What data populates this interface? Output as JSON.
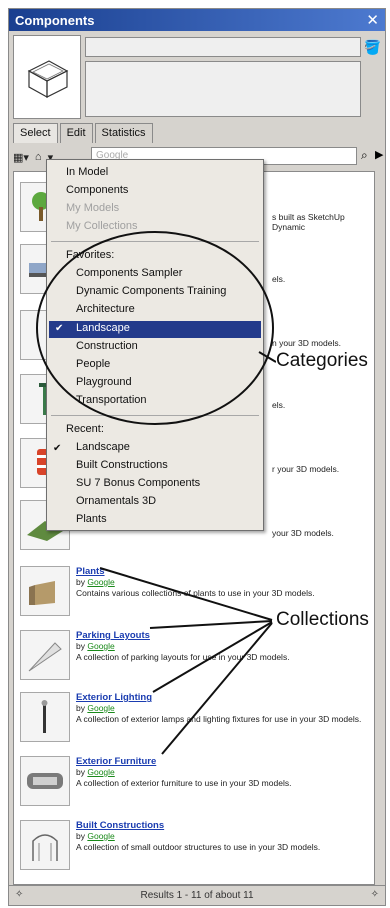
{
  "window": {
    "title": "Components"
  },
  "tabs": [
    {
      "label": "Select"
    },
    {
      "label": "Edit"
    },
    {
      "label": "Statistics"
    }
  ],
  "search": {
    "placeholder": "Google"
  },
  "menu": {
    "top": [
      "In Model",
      "Components"
    ],
    "top_disabled": [
      "My Models",
      "My Collections"
    ],
    "favorites_label": "Favorites:",
    "favorites": [
      "Components Sampler",
      "Dynamic Components Training",
      "Architecture",
      "Landscape",
      "Construction",
      "People",
      "Playground",
      "Transportation"
    ],
    "selected": "Landscape",
    "recent_label": "Recent:",
    "recent": [
      "Landscape",
      "Built Constructions",
      "SU 7 Bonus Components",
      "Ornamentals 3D",
      "Plants"
    ]
  },
  "partial_descriptions": [
    "s built as SketchUp Dynamic",
    "els.",
    "n your 3D models.",
    "els.",
    "r your 3D models.",
    "your 3D models."
  ],
  "results": [
    {
      "title": "Plants",
      "by": "by",
      "author": "Google",
      "desc": "Contains various collections of plants to use in your 3D models."
    },
    {
      "title": "Parking Layouts",
      "by": "by",
      "author": "Google",
      "desc": "A collection of parking layouts for use in your 3D models."
    },
    {
      "title": "Exterior Lighting",
      "by": "by",
      "author": "Google",
      "desc": "A collection of exterior lamps and lighting fixtures for use in your 3D models."
    },
    {
      "title": "Exterior Furniture",
      "by": "by",
      "author": "Google",
      "desc": "A collection of exterior furniture to use in your 3D models."
    },
    {
      "title": "Built Constructions",
      "by": "by",
      "author": "Google",
      "desc": "A collection of small outdoor structures to use in your 3D models."
    }
  ],
  "status": {
    "text": "Results 1 - 11 of about 11"
  },
  "callouts": {
    "categories": "Categories",
    "collections": "Collections"
  },
  "icons": {
    "close": "close-icon",
    "paint": "paint-bucket-icon",
    "view": "view-options-icon",
    "home": "home-icon",
    "search": "search-icon",
    "forward": "forward-icon"
  },
  "colors": {
    "title_bar": "#1a3f8f",
    "selection": "#233a8b",
    "link": "#1a3cb0",
    "author_link": "#1a8a1a"
  }
}
